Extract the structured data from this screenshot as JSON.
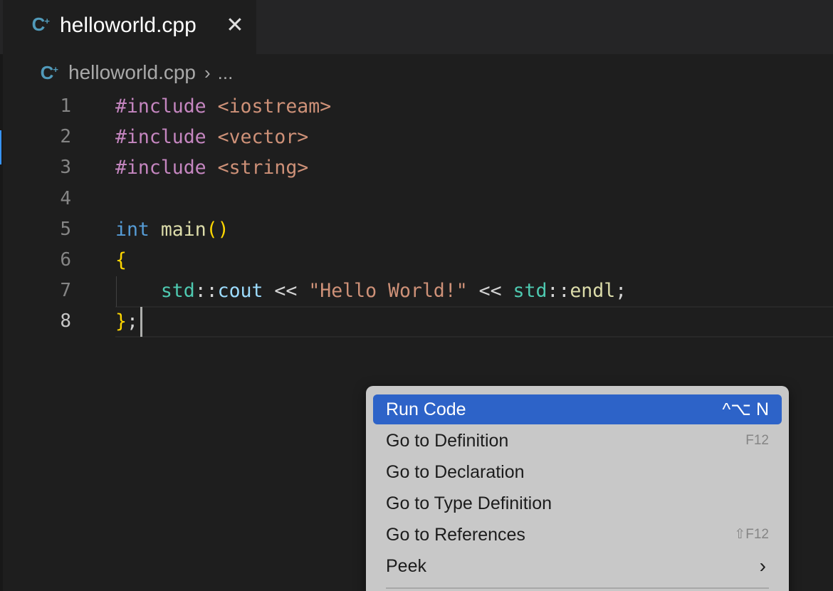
{
  "tab": {
    "label": "helloworld.cpp",
    "close": "✕",
    "icon": "cpp-file-icon"
  },
  "breadcrumb": {
    "file": "helloworld.cpp",
    "separator": "›",
    "more": "..."
  },
  "editor": {
    "line_numbers": [
      "1",
      "2",
      "3",
      "4",
      "5",
      "6",
      "7",
      "8"
    ],
    "active_line": 8
  },
  "code": {
    "l1": {
      "directive": "#include",
      "header": "<iostream>"
    },
    "l2": {
      "directive": "#include",
      "header": "<vector>"
    },
    "l3": {
      "directive": "#include",
      "header": "<string>"
    },
    "l5": {
      "type": "int",
      "fn": "main",
      "parens": "()"
    },
    "l6": {
      "brace": "{"
    },
    "l7": {
      "ns1": "std",
      "sep1": "::",
      "obj": "cout",
      "op1": "<<",
      "str": "\"Hello World!\"",
      "op2": "<<",
      "ns2": "std",
      "sep2": "::",
      "endl": "endl",
      "semi": ";"
    },
    "l8": {
      "brace": "}",
      "semi": ";"
    }
  },
  "context_menu": {
    "items": [
      {
        "label": "Run Code",
        "shortcut": "^⌥ N"
      },
      {
        "label": "Go to Definition",
        "shortcut": "F12"
      },
      {
        "label": "Go to Declaration",
        "shortcut": ""
      },
      {
        "label": "Go to Type Definition",
        "shortcut": ""
      },
      {
        "label": "Go to References",
        "shortcut": "⇧F12"
      },
      {
        "label": "Peek",
        "shortcut": "›"
      }
    ]
  }
}
